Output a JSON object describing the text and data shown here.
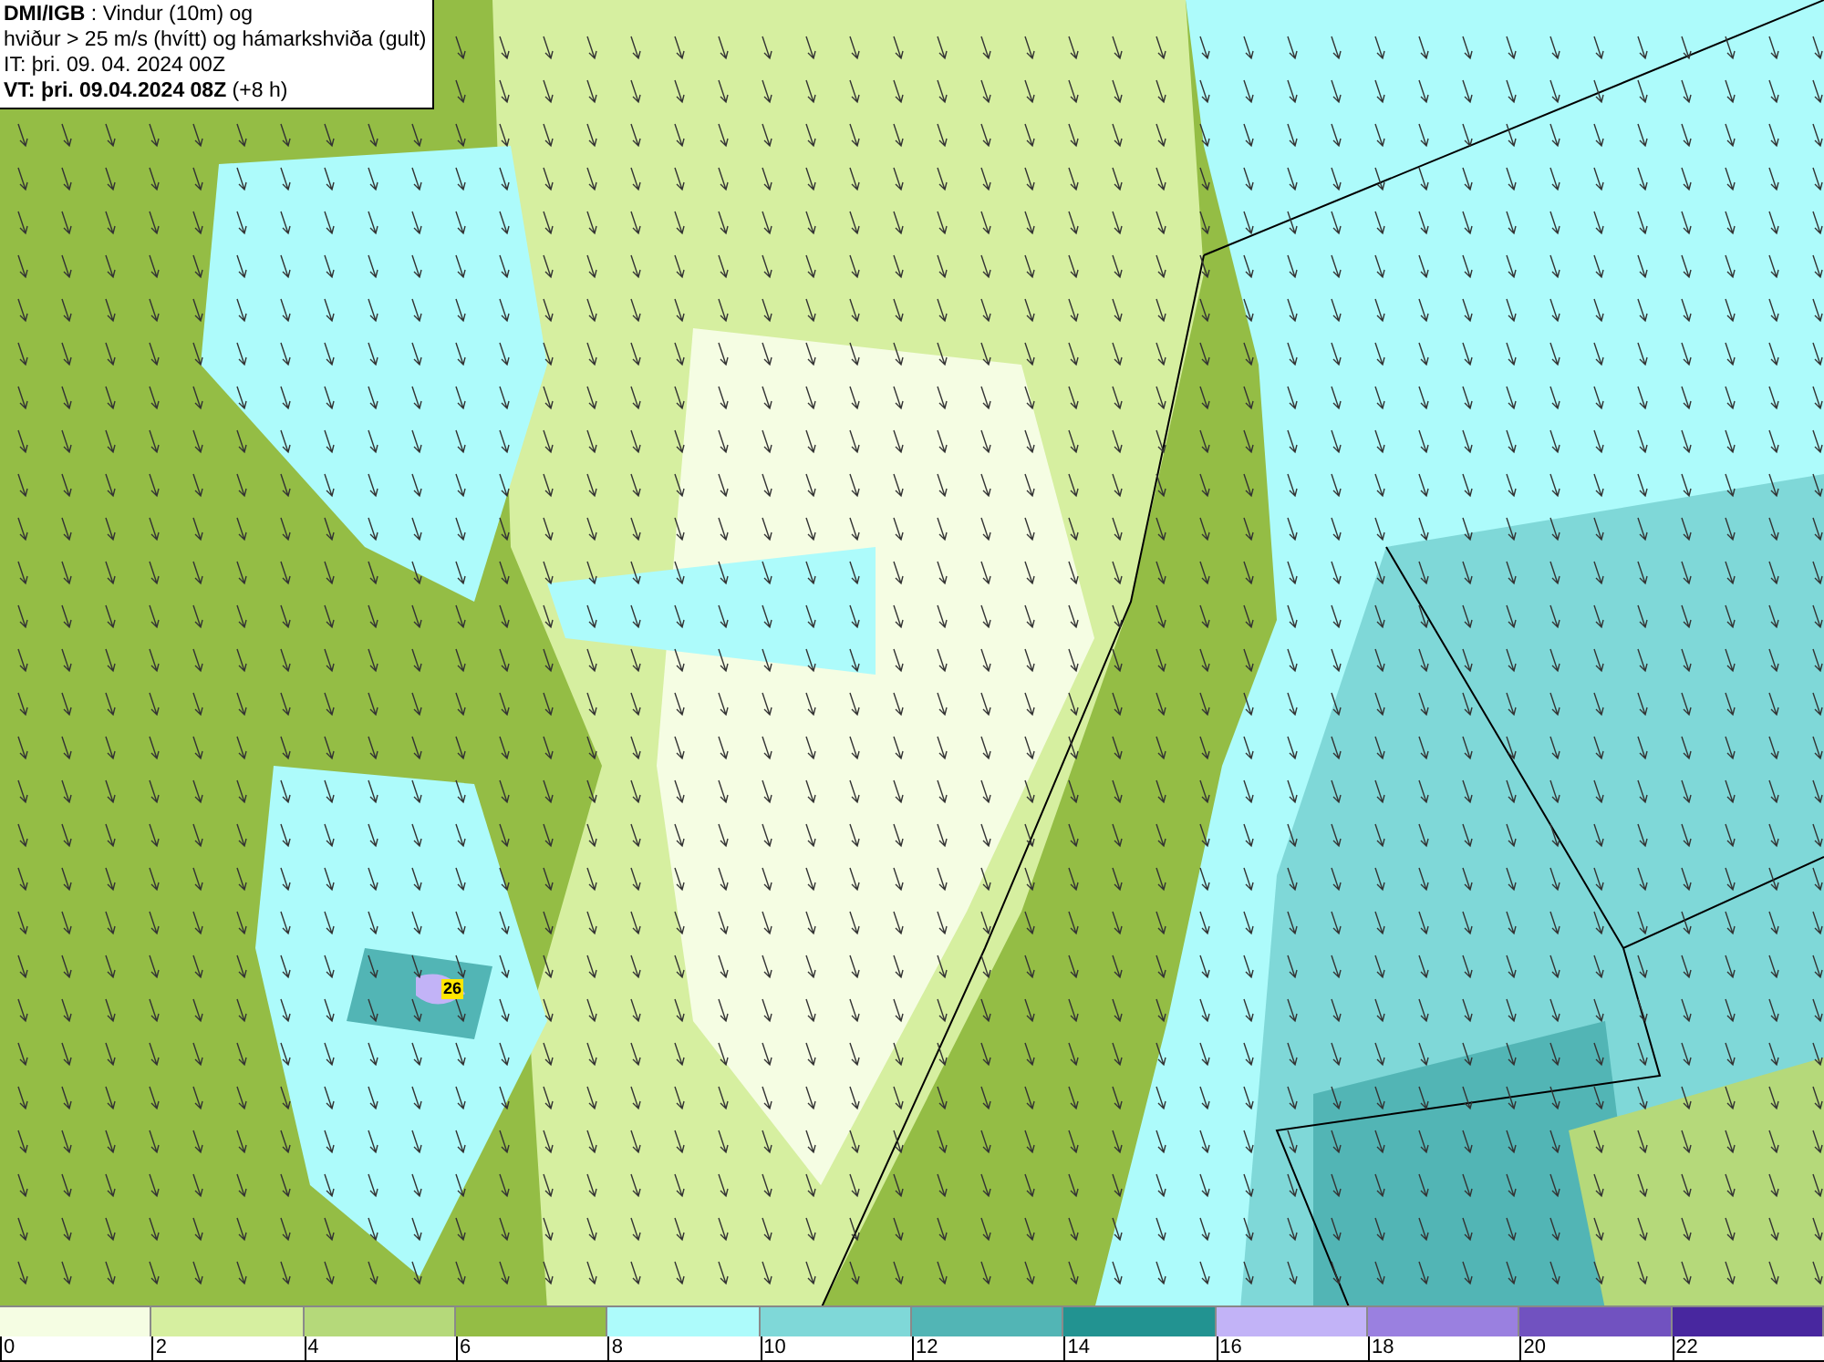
{
  "header": {
    "source": "DMI/IGB",
    "title_rest": " : Vindur (10m) og",
    "line2": "hviður > 25 m/s (hvítt) og hámarkshviða (gult)",
    "issue_time": "IT: þri. 09. 04. 2024 00Z",
    "valid_time_bold": "VT: þri. 09.04.2024 08Z",
    "valid_offset": " (+8 h)"
  },
  "map": {
    "gust_label": "26"
  },
  "legend": [
    {
      "label": "0",
      "color": "#f5fde3"
    },
    {
      "label": "2",
      "color": "#d6efa0"
    },
    {
      "label": "4",
      "color": "#b5d97a"
    },
    {
      "label": "6",
      "color": "#94bd45"
    },
    {
      "label": "8",
      "color": "#adfbfb"
    },
    {
      "label": "10",
      "color": "#7fd8d8"
    },
    {
      "label": "12",
      "color": "#52b5b5"
    },
    {
      "label": "14",
      "color": "#229391"
    },
    {
      "label": "16",
      "color": "#c2b3f7"
    },
    {
      "label": "18",
      "color": "#9a80e0"
    },
    {
      "label": "20",
      "color": "#7152c0"
    },
    {
      "label": "22",
      "color": "#48279f"
    }
  ]
}
